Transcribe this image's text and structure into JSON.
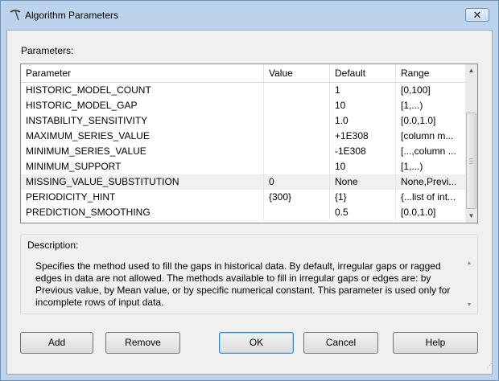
{
  "window": {
    "title": "Algorithm Parameters",
    "close_label": "✕"
  },
  "parameters": {
    "label": "Parameters:",
    "columns": [
      "Parameter",
      "Value",
      "Default",
      "Range"
    ],
    "rows": [
      {
        "parameter": "HISTORIC_MODEL_COUNT",
        "value": "",
        "default": "1",
        "range": "[0,100]"
      },
      {
        "parameter": "HISTORIC_MODEL_GAP",
        "value": "",
        "default": "10",
        "range": "[1,...)"
      },
      {
        "parameter": "INSTABILITY_SENSITIVITY",
        "value": "",
        "default": "1.0",
        "range": "[0.0,1.0]"
      },
      {
        "parameter": "MAXIMUM_SERIES_VALUE",
        "value": "",
        "default": "+1E308",
        "range": "[column m..."
      },
      {
        "parameter": "MINIMUM_SERIES_VALUE",
        "value": "",
        "default": "-1E308",
        "range": "[...,column ..."
      },
      {
        "parameter": "MINIMUM_SUPPORT",
        "value": "",
        "default": "10",
        "range": "[1,...)"
      },
      {
        "parameter": "MISSING_VALUE_SUBSTITUTION",
        "value": "0",
        "default": "None",
        "range": "None,Previ..."
      },
      {
        "parameter": "PERIODICITY_HINT",
        "value": "{300}",
        "default": "{1}",
        "range": "{...list of int..."
      },
      {
        "parameter": "PREDICTION_SMOOTHING",
        "value": "",
        "default": "0.5",
        "range": "[0.0,1.0]"
      }
    ]
  },
  "description": {
    "label": "Description:",
    "text": "Specifies the method used to fill the gaps in historical data. By default, irregular gaps or ragged edges in data are not allowed. The methods available to fill in irregular gaps or edges are: by Previous value, by Mean value, or by specific numerical constant. This parameter is used only for incomplete rows of input data."
  },
  "buttons": {
    "add": "Add",
    "remove": "Remove",
    "ok": "OK",
    "cancel": "Cancel",
    "help": "Help"
  },
  "colors": {
    "frame": "#bcd3ec",
    "client": "#f0f0f0",
    "selected_row": "#f0f0f0"
  }
}
